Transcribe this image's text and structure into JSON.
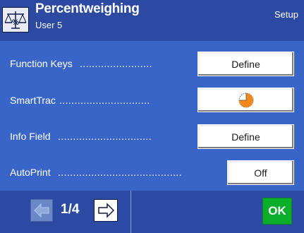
{
  "header": {
    "title": "Percentweighing",
    "user": "User 5",
    "setup_label": "Setup",
    "app_icon": "percent-scale-icon"
  },
  "rows": [
    {
      "label": "Function Keys",
      "dots": "........................",
      "button": "Define"
    },
    {
      "label": "SmartTrac",
      "dots": "..............................",
      "button_icon": "smarttrac-pie-icon"
    },
    {
      "label": "Info Field",
      "dots": "...............................",
      "button": "Define"
    },
    {
      "label": "AutoPrint",
      "dots": ".........................................",
      "button": "Off"
    }
  ],
  "footer": {
    "prev_icon": "arrow-left-icon",
    "page_indicator": "1/4",
    "next_icon": "arrow-right-icon",
    "ok_label": "OK"
  },
  "colors": {
    "header_bg": "#2c4aa2",
    "content_bg": "#3a65c8",
    "ok_green": "#0bae2b",
    "smarttrac_orange": "#f2871e"
  }
}
